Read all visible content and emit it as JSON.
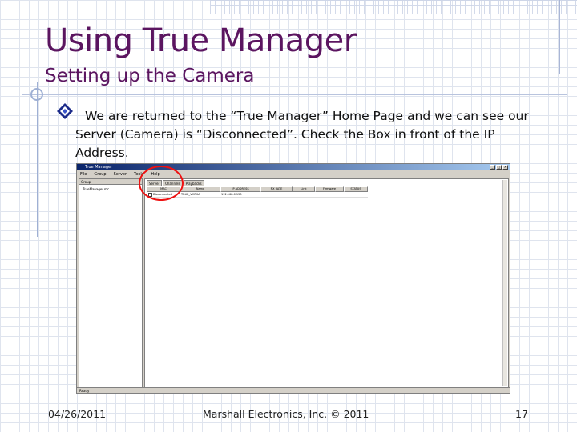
{
  "slide": {
    "title": "Using True Manager",
    "subtitle": "Setting up the Camera",
    "body": "We are returned to the “True Manager” Home Page and we can see our Server (Camera) is “Disconnected”.  Check the Box in front of the IP Address.",
    "bullet_icon": "diamond-bullet-icon",
    "footer_date": "04/26/2011",
    "footer_center": "Marshall Electronics, Inc. © 2011",
    "page_number": "17",
    "colors": {
      "title": "#5b1560",
      "highlight_circle": "#e11111"
    }
  },
  "screenshot": {
    "window_title": "True Manager",
    "menu": [
      "File",
      "Group",
      "Server",
      "Tools",
      "Help"
    ],
    "left_panel": {
      "header": "Group",
      "items": [
        "TrueManager.mc"
      ]
    },
    "tabs": [
      "Server",
      "Channels",
      "Playbacks"
    ],
    "table": {
      "columns": [
        "MAC",
        "Name",
        "IP ADDRESS",
        "RX RATE",
        "Link",
        "Firmware",
        "STATUS"
      ],
      "rows": [
        {
          "checked": false,
          "mac": "Disconnected",
          "name": "TRUE_VMR0A",
          "ip": "192.168.0.150",
          "rx": "",
          "link": "",
          "firmware": "",
          "status": ""
        }
      ]
    },
    "status_bar": "Ready"
  }
}
